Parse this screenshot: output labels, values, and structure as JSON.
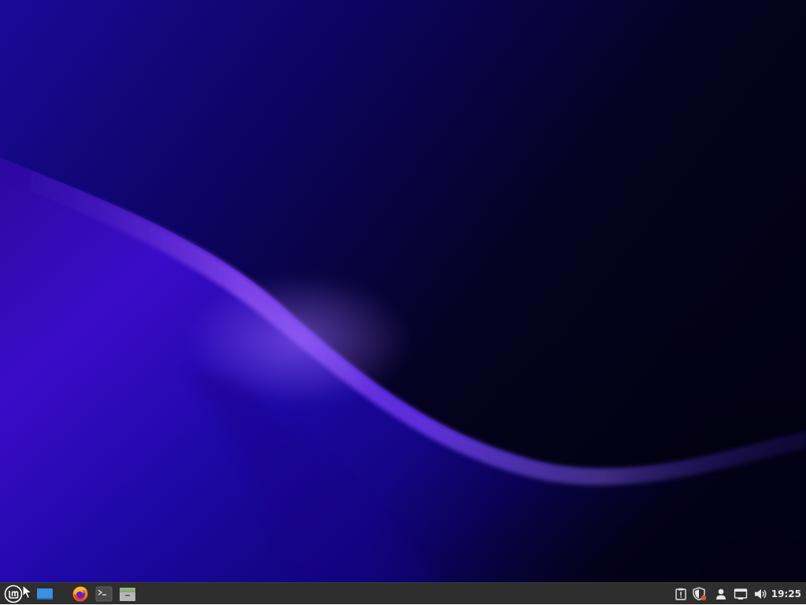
{
  "wallpaper": {
    "name": "wallpaper",
    "colors": {
      "deep": "#05021e",
      "indigo": "#1a0a8c",
      "violet": "#3a0cc0",
      "glow": "#a066ff"
    }
  },
  "panel": {
    "background": "#2e2e2e",
    "menu_icon": "linux-mint-menu-icon",
    "launchers": [
      {
        "icon": "show-desktop-icon"
      },
      {
        "icon": "firefox-icon"
      },
      {
        "icon": "terminal-icon"
      },
      {
        "icon": "file-manager-icon"
      }
    ],
    "tray": [
      {
        "icon": "clipboard-notes-icon"
      },
      {
        "icon": "update-manager-shield-icon"
      },
      {
        "icon": "user-icon"
      },
      {
        "icon": "network-icon"
      },
      {
        "icon": "volume-icon"
      }
    ],
    "clock": "19:25"
  }
}
